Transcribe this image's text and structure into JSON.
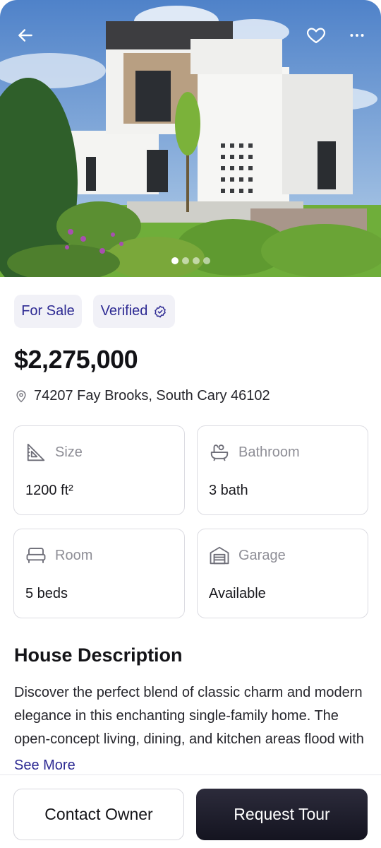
{
  "badges": {
    "sale": "For Sale",
    "verified": "Verified"
  },
  "listing": {
    "price": "$2,275,000",
    "address": "74207 Fay Brooks, South Cary 46102"
  },
  "features": [
    {
      "label": "Size",
      "value": "1200 ft²",
      "icon": "ruler-triangle-icon"
    },
    {
      "label": "Bathroom",
      "value": "3 bath",
      "icon": "bathtub-icon"
    },
    {
      "label": "Room",
      "value": "5 beds",
      "icon": "bed-icon"
    },
    {
      "label": "Garage",
      "value": "Available",
      "icon": "garage-icon"
    }
  ],
  "description": {
    "title": "House Description",
    "text": "Discover the perfect blend of classic charm and modern elegance in this enchanting single-family home. The open-concept living, dining, and kitchen areas flood with natura...",
    "see_more": "See More"
  },
  "actions": {
    "contact": "Contact Owner",
    "tour": "Request Tour"
  },
  "gallery": {
    "total_images": 4,
    "active_index": 0
  },
  "colors": {
    "accent": "#2d2a93",
    "chip_bg": "#f1f1f7",
    "primary_button": "#1c1b28"
  }
}
